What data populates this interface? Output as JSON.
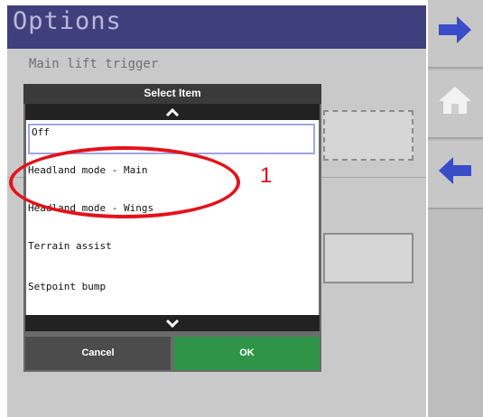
{
  "page": {
    "title": "Options",
    "section_label": "Main lift trigger"
  },
  "side_nav": {
    "items": [
      {
        "icon": "arrow-right-icon"
      },
      {
        "icon": "home-icon"
      },
      {
        "icon": "arrow-left-icon"
      }
    ]
  },
  "dialog": {
    "title": "Select Item",
    "items": [
      {
        "label": "Off",
        "selected": true
      },
      {
        "label": "Headland mode - Main"
      },
      {
        "label": "Headland mode - Wings"
      },
      {
        "label": "Terrain assist"
      },
      {
        "label": "Setpoint bump"
      }
    ],
    "cancel_label": "Cancel",
    "ok_label": "OK"
  },
  "annotation": {
    "number": "1"
  },
  "colors": {
    "title_bar": "#3f3f7e",
    "nav_arrow": "#3a4cc8",
    "ok_button": "#2f9447",
    "annotation": "#e3121b"
  }
}
